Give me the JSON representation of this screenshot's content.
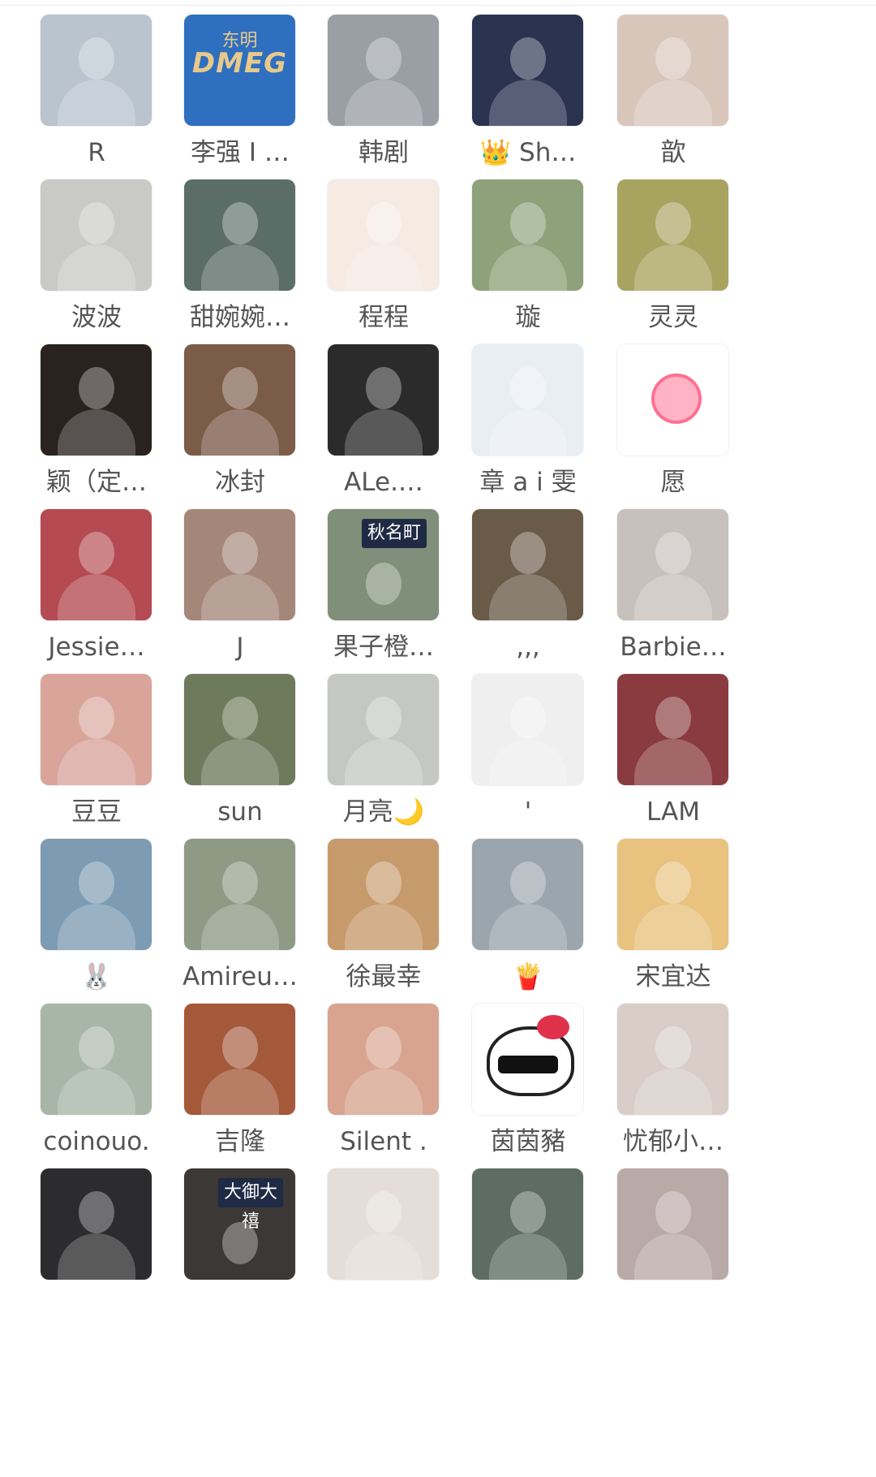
{
  "members": [
    {
      "name": "R",
      "color": "#b9c4cf",
      "icon": "person-photo"
    },
    {
      "name": "李强 I …",
      "color": "#2f6fc0",
      "icon": "brand-logo",
      "logo_text": "DMEG",
      "logo_sub": "东明"
    },
    {
      "name": "韩剧",
      "color": "#9a9fa5",
      "icon": "person-photo"
    },
    {
      "name": "👑 Sh…",
      "color": "#2a3350",
      "icon": "person-photo"
    },
    {
      "name": "歆",
      "color": "#d9c6bb",
      "icon": "person-photo"
    },
    {
      "name": "波波",
      "color": "#c9c9c6",
      "icon": "person-photo"
    },
    {
      "name": "甜婉婉…",
      "color": "#5a6e67",
      "icon": "person-photo"
    },
    {
      "name": "程程",
      "color": "#f6eae3",
      "icon": "cartoon-girl"
    },
    {
      "name": "璇",
      "color": "#8da27a",
      "icon": "person-photo"
    },
    {
      "name": "灵灵",
      "color": "#a9a360",
      "icon": "person-photo"
    },
    {
      "name": "颖（定…",
      "color": "#2a221f",
      "icon": "person-photo"
    },
    {
      "name": "冰封",
      "color": "#7b5c49",
      "icon": "person-photo"
    },
    {
      "name": "ALe.…",
      "color": "#2b2b2b",
      "icon": "person-photo"
    },
    {
      "name": "章 a i 雯",
      "color": "#e9eef3",
      "icon": "cartoon-girl"
    },
    {
      "name": "愿",
      "color": "#ffffff",
      "icon": "sun-icon"
    },
    {
      "name": "Jessie…",
      "color": "#b54a52",
      "icon": "person-photo"
    },
    {
      "name": "J",
      "color": "#a5877a",
      "icon": "person-photo"
    },
    {
      "name": "果子橙…",
      "color": "#7f8f7a",
      "icon": "street-sign",
      "sign_text": "秋名町"
    },
    {
      "name": ",,,",
      "color": "#6a5a48",
      "icon": "person-photo"
    },
    {
      "name": "Barbie…",
      "color": "#c7c0bc",
      "icon": "person-photo"
    },
    {
      "name": "豆豆",
      "color": "#d9a59b",
      "icon": "person-photo"
    },
    {
      "name": "sun",
      "color": "#6e7a5c",
      "icon": "person-photo"
    },
    {
      "name": "月亮🌙",
      "color": "#c5c8c2",
      "icon": "person-photo"
    },
    {
      "name": "'",
      "color": "#efefef",
      "icon": "person-photo"
    },
    {
      "name": "LAM",
      "color": "#8a3b3f",
      "icon": "person-photo"
    },
    {
      "name": "🐰",
      "color": "#7d9bb2",
      "icon": "rabbit-photo"
    },
    {
      "name": "Amireu…",
      "color": "#8e9a84",
      "icon": "person-photo"
    },
    {
      "name": "徐最幸",
      "color": "#c79a6b",
      "icon": "person-photo"
    },
    {
      "name": "🍟",
      "color": "#9aa5ad",
      "icon": "person-photo"
    },
    {
      "name": "宋宜达",
      "color": "#e8c27e",
      "icon": "illustration"
    },
    {
      "name": "coinouo.",
      "color": "#a7b6a6",
      "icon": "person-photo"
    },
    {
      "name": "吉隆",
      "color": "#a4593a",
      "icon": "bracelet-photo"
    },
    {
      "name": "Silent .",
      "color": "#d8a490",
      "icon": "person-photo"
    },
    {
      "name": "茵茵豬",
      "color": "#ffffff",
      "icon": "hello-kitty"
    },
    {
      "name": "忧郁小…",
      "color": "#d8cec7",
      "icon": "person-photo"
    },
    {
      "name": "",
      "color": "#2c2c2e",
      "icon": "person-photo"
    },
    {
      "name": "",
      "color": "#3b3835",
      "icon": "street-sign",
      "sign_text": "大御大禧"
    },
    {
      "name": "",
      "color": "#e4ddd8",
      "icon": "person-photo"
    },
    {
      "name": "",
      "color": "#5d6d63",
      "icon": "person-photo"
    },
    {
      "name": "",
      "color": "#b9a9a7",
      "icon": "cat-photo"
    }
  ]
}
